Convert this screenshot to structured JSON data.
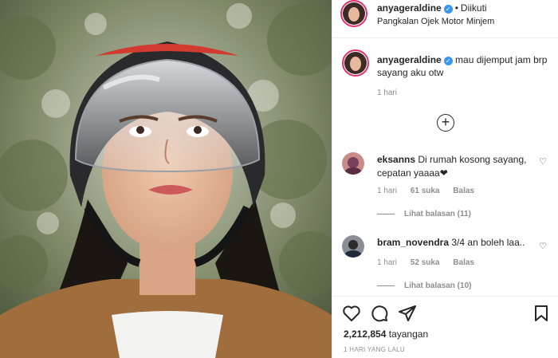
{
  "post": {
    "username": "anyageraldine",
    "separator": "•",
    "follow_status": "Diikuti",
    "location": "Pangkalan Ojek Motor Minjem",
    "caption_user": "anyageraldine",
    "caption_text": "mau dijemput jam brp sayang aku otw",
    "caption_time": "1 hari",
    "load_more_icon": "+",
    "views_count": "2,212,854",
    "views_label": "tayangan",
    "posted_ago": "1 HARI YANG LALU"
  },
  "comments": [
    {
      "user": "eksanns",
      "text": "Di rumah kosong sayang, cepatan yaaaa❤",
      "time": "1 hari",
      "likes": "61 suka",
      "reply_label": "Balas",
      "replies": "Lihat balasan (11)"
    },
    {
      "user": "bram_novendra",
      "text": "3/4 an boleh laa..",
      "time": "1 hari",
      "likes": "52 suka",
      "reply_label": "Balas",
      "replies": "Lihat balasan (10)"
    }
  ],
  "icons": {
    "like": "heart-icon",
    "comment": "comment-icon",
    "share": "share-icon",
    "save": "bookmark-icon",
    "comment_like": "♡"
  },
  "colors": {
    "verified": "#3897f0",
    "story_ring": "#e1306c",
    "muted": "#8e8e8e"
  }
}
